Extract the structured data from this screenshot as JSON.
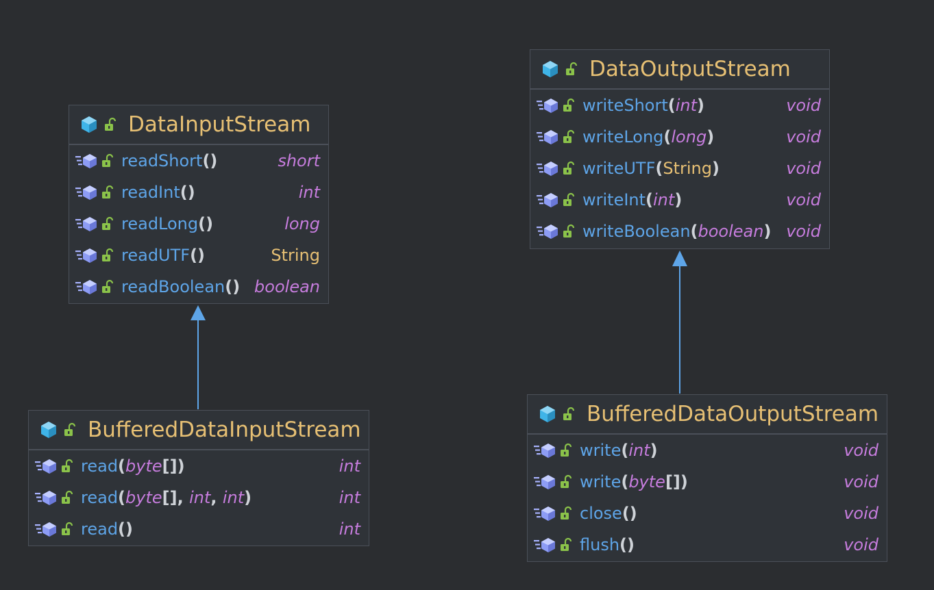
{
  "colors": {
    "background": "#2b2d30",
    "box_fill": "#2f3338",
    "box_border": "#4b5059",
    "class_name": "#e7c074",
    "method_name": "#5ea5e8",
    "type_keyword": "#c77dde",
    "class_icon": "#3fb4e8",
    "lock_icon": "#8bc34a",
    "arrow": "#5ea5e8"
  },
  "classes": {
    "data_input_stream": {
      "name": "DataInputStream",
      "methods": [
        {
          "name": "readShort",
          "open": "(",
          "params": [],
          "close": ")",
          "ret": "short"
        },
        {
          "name": "readInt",
          "open": "(",
          "params": [],
          "close": ")",
          "ret": "int"
        },
        {
          "name": "readLong",
          "open": "(",
          "params": [],
          "close": ")",
          "ret": "long"
        },
        {
          "name": "readUTF",
          "open": "(",
          "params": [],
          "close": ")",
          "ret": "String"
        },
        {
          "name": "readBoolean",
          "open": "(",
          "params": [],
          "close": ")",
          "ret": "boolean"
        }
      ]
    },
    "buffered_data_input_stream": {
      "name": "BufferedDataInputStream",
      "methods": [
        {
          "name": "read",
          "open": "(",
          "params": [
            {
              "type": "byte",
              "suffix": "[]"
            }
          ],
          "close": ")",
          "ret": "int"
        },
        {
          "name": "read",
          "open": "(",
          "params": [
            {
              "type": "byte",
              "suffix": "[]"
            },
            {
              "type": "int",
              "suffix": ""
            },
            {
              "type": "int",
              "suffix": ""
            }
          ],
          "close": ")",
          "ret": "int"
        },
        {
          "name": "read",
          "open": "(",
          "params": [],
          "close": ")",
          "ret": "int"
        }
      ]
    },
    "data_output_stream": {
      "name": "DataOutputStream",
      "methods": [
        {
          "name": "writeShort",
          "open": "(",
          "params": [
            {
              "type": "int",
              "suffix": ""
            }
          ],
          "close": ")",
          "ret": "void"
        },
        {
          "name": "writeLong",
          "open": "(",
          "params": [
            {
              "type": "long",
              "suffix": ""
            }
          ],
          "close": ")",
          "ret": "void"
        },
        {
          "name": "writeUTF",
          "open": "(",
          "params": [
            {
              "type": "String",
              "suffix": "",
              "plain": true
            }
          ],
          "close": ")",
          "ret": "void"
        },
        {
          "name": "writeInt",
          "open": "(",
          "params": [
            {
              "type": "int",
              "suffix": ""
            }
          ],
          "close": ")",
          "ret": "void"
        },
        {
          "name": "writeBoolean",
          "open": "(",
          "params": [
            {
              "type": "boolean",
              "suffix": ""
            }
          ],
          "close": ")",
          "ret": "void"
        }
      ]
    },
    "buffered_data_output_stream": {
      "name": "BufferedDataOutputStream",
      "methods": [
        {
          "name": "write",
          "open": "(",
          "params": [
            {
              "type": "int",
              "suffix": ""
            }
          ],
          "close": ")",
          "ret": "void"
        },
        {
          "name": "write",
          "open": "(",
          "params": [
            {
              "type": "byte",
              "suffix": "[]"
            }
          ],
          "close": ")",
          "ret": "void"
        },
        {
          "name": "close",
          "open": "(",
          "params": [],
          "close": ")",
          "ret": "void"
        },
        {
          "name": "flush",
          "open": "(",
          "params": [],
          "close": ")",
          "ret": "void"
        }
      ]
    }
  },
  "relations": [
    {
      "type": "inheritance",
      "from": "buffered_data_input_stream",
      "to": "data_input_stream"
    },
    {
      "type": "inheritance",
      "from": "buffered_data_output_stream",
      "to": "data_output_stream"
    }
  ]
}
